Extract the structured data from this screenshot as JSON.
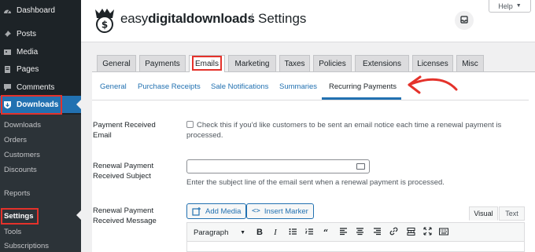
{
  "sidebar": {
    "items": [
      {
        "label": "Dashboard",
        "icon": "dashboard-icon"
      },
      {
        "label": "Posts",
        "icon": "pin-icon"
      },
      {
        "label": "Media",
        "icon": "media-icon"
      },
      {
        "label": "Pages",
        "icon": "page-icon"
      },
      {
        "label": "Comments",
        "icon": "comment-icon"
      },
      {
        "label": "Downloads",
        "icon": "download-shield-icon"
      }
    ],
    "submenu": [
      "Downloads",
      "Orders",
      "Customers",
      "Discounts",
      "Reports",
      "Settings",
      "Tools",
      "Subscriptions"
    ]
  },
  "header": {
    "brand_regular": "easy",
    "brand_bold": "digitaldownloads",
    "separator": "/",
    "title": "Settings",
    "help_label": "Help"
  },
  "tabs": [
    "General",
    "Payments",
    "Emails",
    "Marketing",
    "Taxes",
    "Policies",
    "Extensions",
    "Licenses",
    "Misc"
  ],
  "active_tab": "Emails",
  "subtabs": [
    "General",
    "Purchase Receipts",
    "Sale Notifications",
    "Summaries",
    "Recurring Payments"
  ],
  "active_subtab": "Recurring Payments",
  "form": {
    "payment_received": {
      "label_line1": "Payment Received",
      "label_line2": "Email",
      "checkbox_text_line1": "Check this if you'd like customers to be sent an email notice each time a renewal payment is",
      "checkbox_text_line2": "processed.",
      "checked": false
    },
    "subject": {
      "label_line1": "Renewal Payment",
      "label_line2": "Received Subject",
      "value": "",
      "help": "Enter the subject line of the email sent when a renewal payment is processed."
    },
    "message": {
      "label_line1": "Renewal Payment",
      "label_line2": "Received Message",
      "add_media": "Add Media",
      "insert_marker": "Insert Marker",
      "editor_tabs": [
        "Visual",
        "Text"
      ],
      "active_editor_tab": "Visual",
      "format_select": "Paragraph"
    }
  },
  "colors": {
    "accent": "#2271b1",
    "highlight": "#e4322b",
    "sidebar": "#1d2327"
  }
}
